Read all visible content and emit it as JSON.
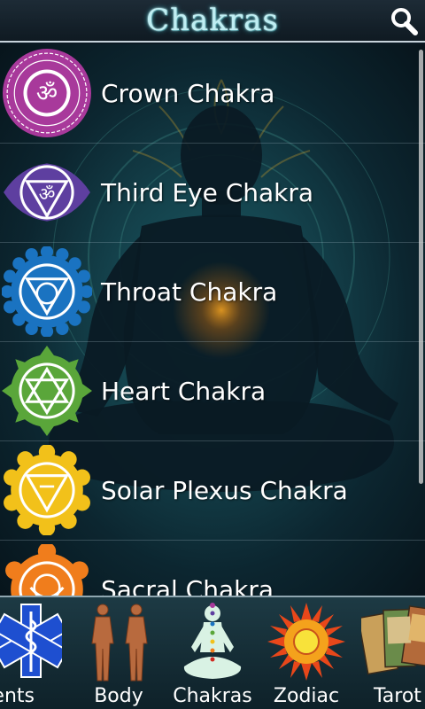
{
  "header": {
    "title": "Chakras",
    "search_icon": "search-icon"
  },
  "chakras": [
    {
      "label": "Crown Chakra",
      "color": "#a8399b"
    },
    {
      "label": "Third Eye Chakra",
      "color": "#5e3fa0"
    },
    {
      "label": "Throat Chakra",
      "color": "#1a73c1"
    },
    {
      "label": "Heart Chakra",
      "color": "#5aa63a"
    },
    {
      "label": "Solar Plexus Chakra",
      "color": "#f2c11a"
    },
    {
      "label": "Sacral Chakra",
      "color": "#f07d1c"
    }
  ],
  "tabs": [
    {
      "label": "ments",
      "icon": "medical-star-icon"
    },
    {
      "label": "Body",
      "icon": "anatomy-figures-icon"
    },
    {
      "label": "Chakras",
      "icon": "meditation-figure-icon"
    },
    {
      "label": "Zodiac",
      "icon": "sun-icon"
    },
    {
      "label": "Tarot",
      "icon": "tarot-cards-icon"
    }
  ]
}
